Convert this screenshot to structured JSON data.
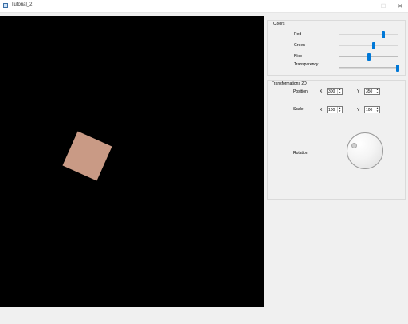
{
  "window": {
    "title": "Tutorial_2",
    "minimize_glyph": "—",
    "maximize_glyph": "☐",
    "close_glyph": "✕"
  },
  "viewport": {
    "background": "#000000",
    "shape_color": "#c99a85"
  },
  "colors_group": {
    "title": "Colors",
    "sliders": [
      {
        "label": "Red",
        "value_fraction": 0.75
      },
      {
        "label": "Green",
        "value_fraction": 0.58
      },
      {
        "label": "Blue",
        "value_fraction": 0.5
      },
      {
        "label": "Transparency",
        "value_fraction": 0.98
      }
    ],
    "accent": "#0078d7"
  },
  "transform_group": {
    "title": "Transformations 2D",
    "position_label": "Position",
    "scale_label": "Scale",
    "rotation_label": "Rotation",
    "x_label": "X",
    "y_label": "Y",
    "position_x": "300",
    "position_y": "350",
    "scale_x": "100",
    "scale_y": "100",
    "spin_up": "▲",
    "spin_down": "▼"
  }
}
